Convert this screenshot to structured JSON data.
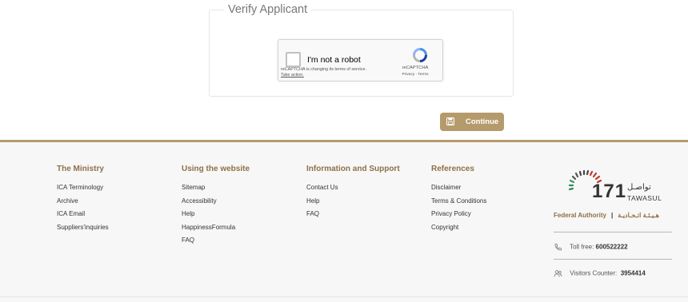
{
  "verify": {
    "title": "Verify Applicant",
    "recaptcha": {
      "label": "I'm not a robot",
      "notice": "reCAPTCHA is changing its terms of service.",
      "take_action": "Take action.",
      "brand": "reCAPTCHA",
      "privacy_terms": "Privacy - Terms"
    }
  },
  "continue_button": {
    "label": "Continue",
    "icon": "save-icon"
  },
  "footer": {
    "columns": [
      {
        "title": "The Ministry",
        "links": [
          "ICA Terminology",
          "Archive",
          "ICA Email",
          "Suppliers'inquiries"
        ]
      },
      {
        "title": "Using the website",
        "links": [
          "Sitemap",
          "Accessibility",
          "Help",
          "HappinessFormula",
          "FAQ"
        ]
      },
      {
        "title": "Information and Support",
        "links": [
          "Contact Us",
          "Help",
          "FAQ"
        ]
      },
      {
        "title": "References",
        "links": [
          "Disclaimer",
          "Terms & Conditions",
          "Privacy Policy",
          "Copyright"
        ]
      }
    ],
    "logo": {
      "number": "171",
      "arabic_name": "تواصـل",
      "english_name": "TAWASUL",
      "authority_en": "Federal Authority",
      "authority_ar": "هـيـئـة اتـحـاديـة"
    },
    "toll_free_label": "Toll free:",
    "toll_free_number": "600522222",
    "visitors_label": "Visitors Counter:",
    "visitors_count": "3954414"
  },
  "colors": {
    "accent": "#b59a6c",
    "heading": "#8f7047",
    "footer_bg": "#f7f7f7"
  }
}
